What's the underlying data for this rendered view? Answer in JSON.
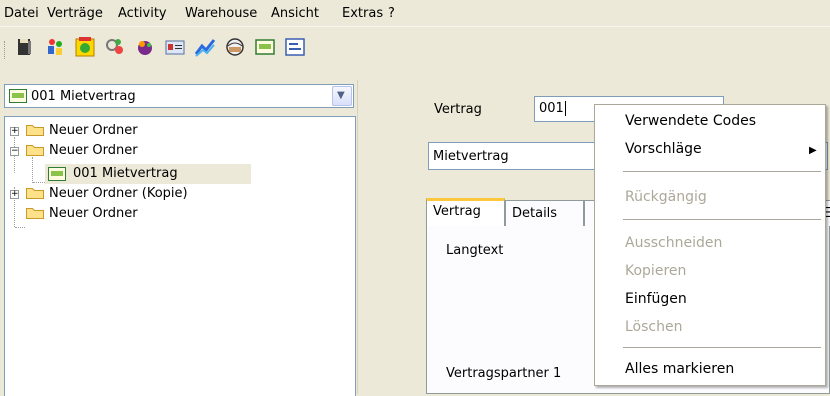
{
  "menubar": {
    "items": [
      "Datei",
      "Verträge",
      "Activity",
      "Warehouse",
      "Ansicht",
      "Extras",
      "?"
    ]
  },
  "toolbar": {
    "icons": [
      "book-icon",
      "people-icon",
      "calendar-icon",
      "gear-group-icon",
      "gift-icon",
      "card-icon",
      "chart-icon",
      "globe-icon",
      "contract-icon",
      "list-icon"
    ]
  },
  "left": {
    "combo_value": "001 Mietvertrag",
    "tree": [
      {
        "label": "Neuer Ordner",
        "expander": "+"
      },
      {
        "label": "Neuer Ordner",
        "expander": "−"
      },
      {
        "label": "001 Mietvertrag",
        "expander": ""
      },
      {
        "label": "Neuer Ordner (Kopie)",
        "expander": "+"
      },
      {
        "label": "Neuer Ordner",
        "expander": ""
      }
    ]
  },
  "right": {
    "vertrag_label": "Vertrag",
    "vertrag_value": "001",
    "name_value": "Mietvertrag",
    "tabs": [
      "Vertrag",
      "Details",
      "",
      "E"
    ],
    "langtext_label": "Langtext",
    "vertragspartner_label": "Vertragspartner 1"
  },
  "context_menu": {
    "items": [
      {
        "label": "Verwendete Codes",
        "enabled": true
      },
      {
        "label": "Vorschläge",
        "enabled": true,
        "submenu": "▶"
      },
      {
        "label": "Rückgängig",
        "enabled": false
      },
      {
        "label": "Ausschneiden",
        "enabled": false
      },
      {
        "label": "Kopieren",
        "enabled": false
      },
      {
        "label": "Einfügen",
        "enabled": true
      },
      {
        "label": "Löschen",
        "enabled": false
      },
      {
        "label": "Alles markieren",
        "enabled": true
      }
    ]
  }
}
